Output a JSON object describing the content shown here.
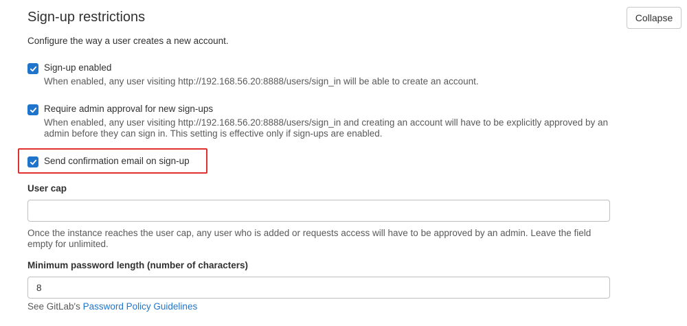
{
  "section": {
    "title": "Sign-up restrictions",
    "collapse_label": "Collapse",
    "description": "Configure the way a user creates a new account."
  },
  "checkboxes": [
    {
      "label": "Sign-up enabled",
      "checked": true,
      "help": "When enabled, any user visiting http://192.168.56.20:8888/users/sign_in will be able to create an account."
    },
    {
      "label": "Require admin approval for new sign-ups",
      "checked": true,
      "help": "When enabled, any user visiting http://192.168.56.20:8888/users/sign_in and creating an account will have to be explicitly approved by an admin before they can sign in. This setting is effective only if sign-ups are enabled."
    },
    {
      "label": "Send confirmation email on sign-up",
      "checked": true,
      "help": ""
    }
  ],
  "user_cap": {
    "label": "User cap",
    "value": "",
    "help": "Once the instance reaches the user cap, any user who is added or requests access will have to be approved by an admin. Leave the field empty for unlimited."
  },
  "min_password": {
    "label": "Minimum password length (number of characters)",
    "value": "8",
    "help_prefix": "See GitLab's ",
    "help_link": "Password Policy Guidelines"
  },
  "colors": {
    "accent": "#1f75cb",
    "highlight": "#e02f2f"
  }
}
